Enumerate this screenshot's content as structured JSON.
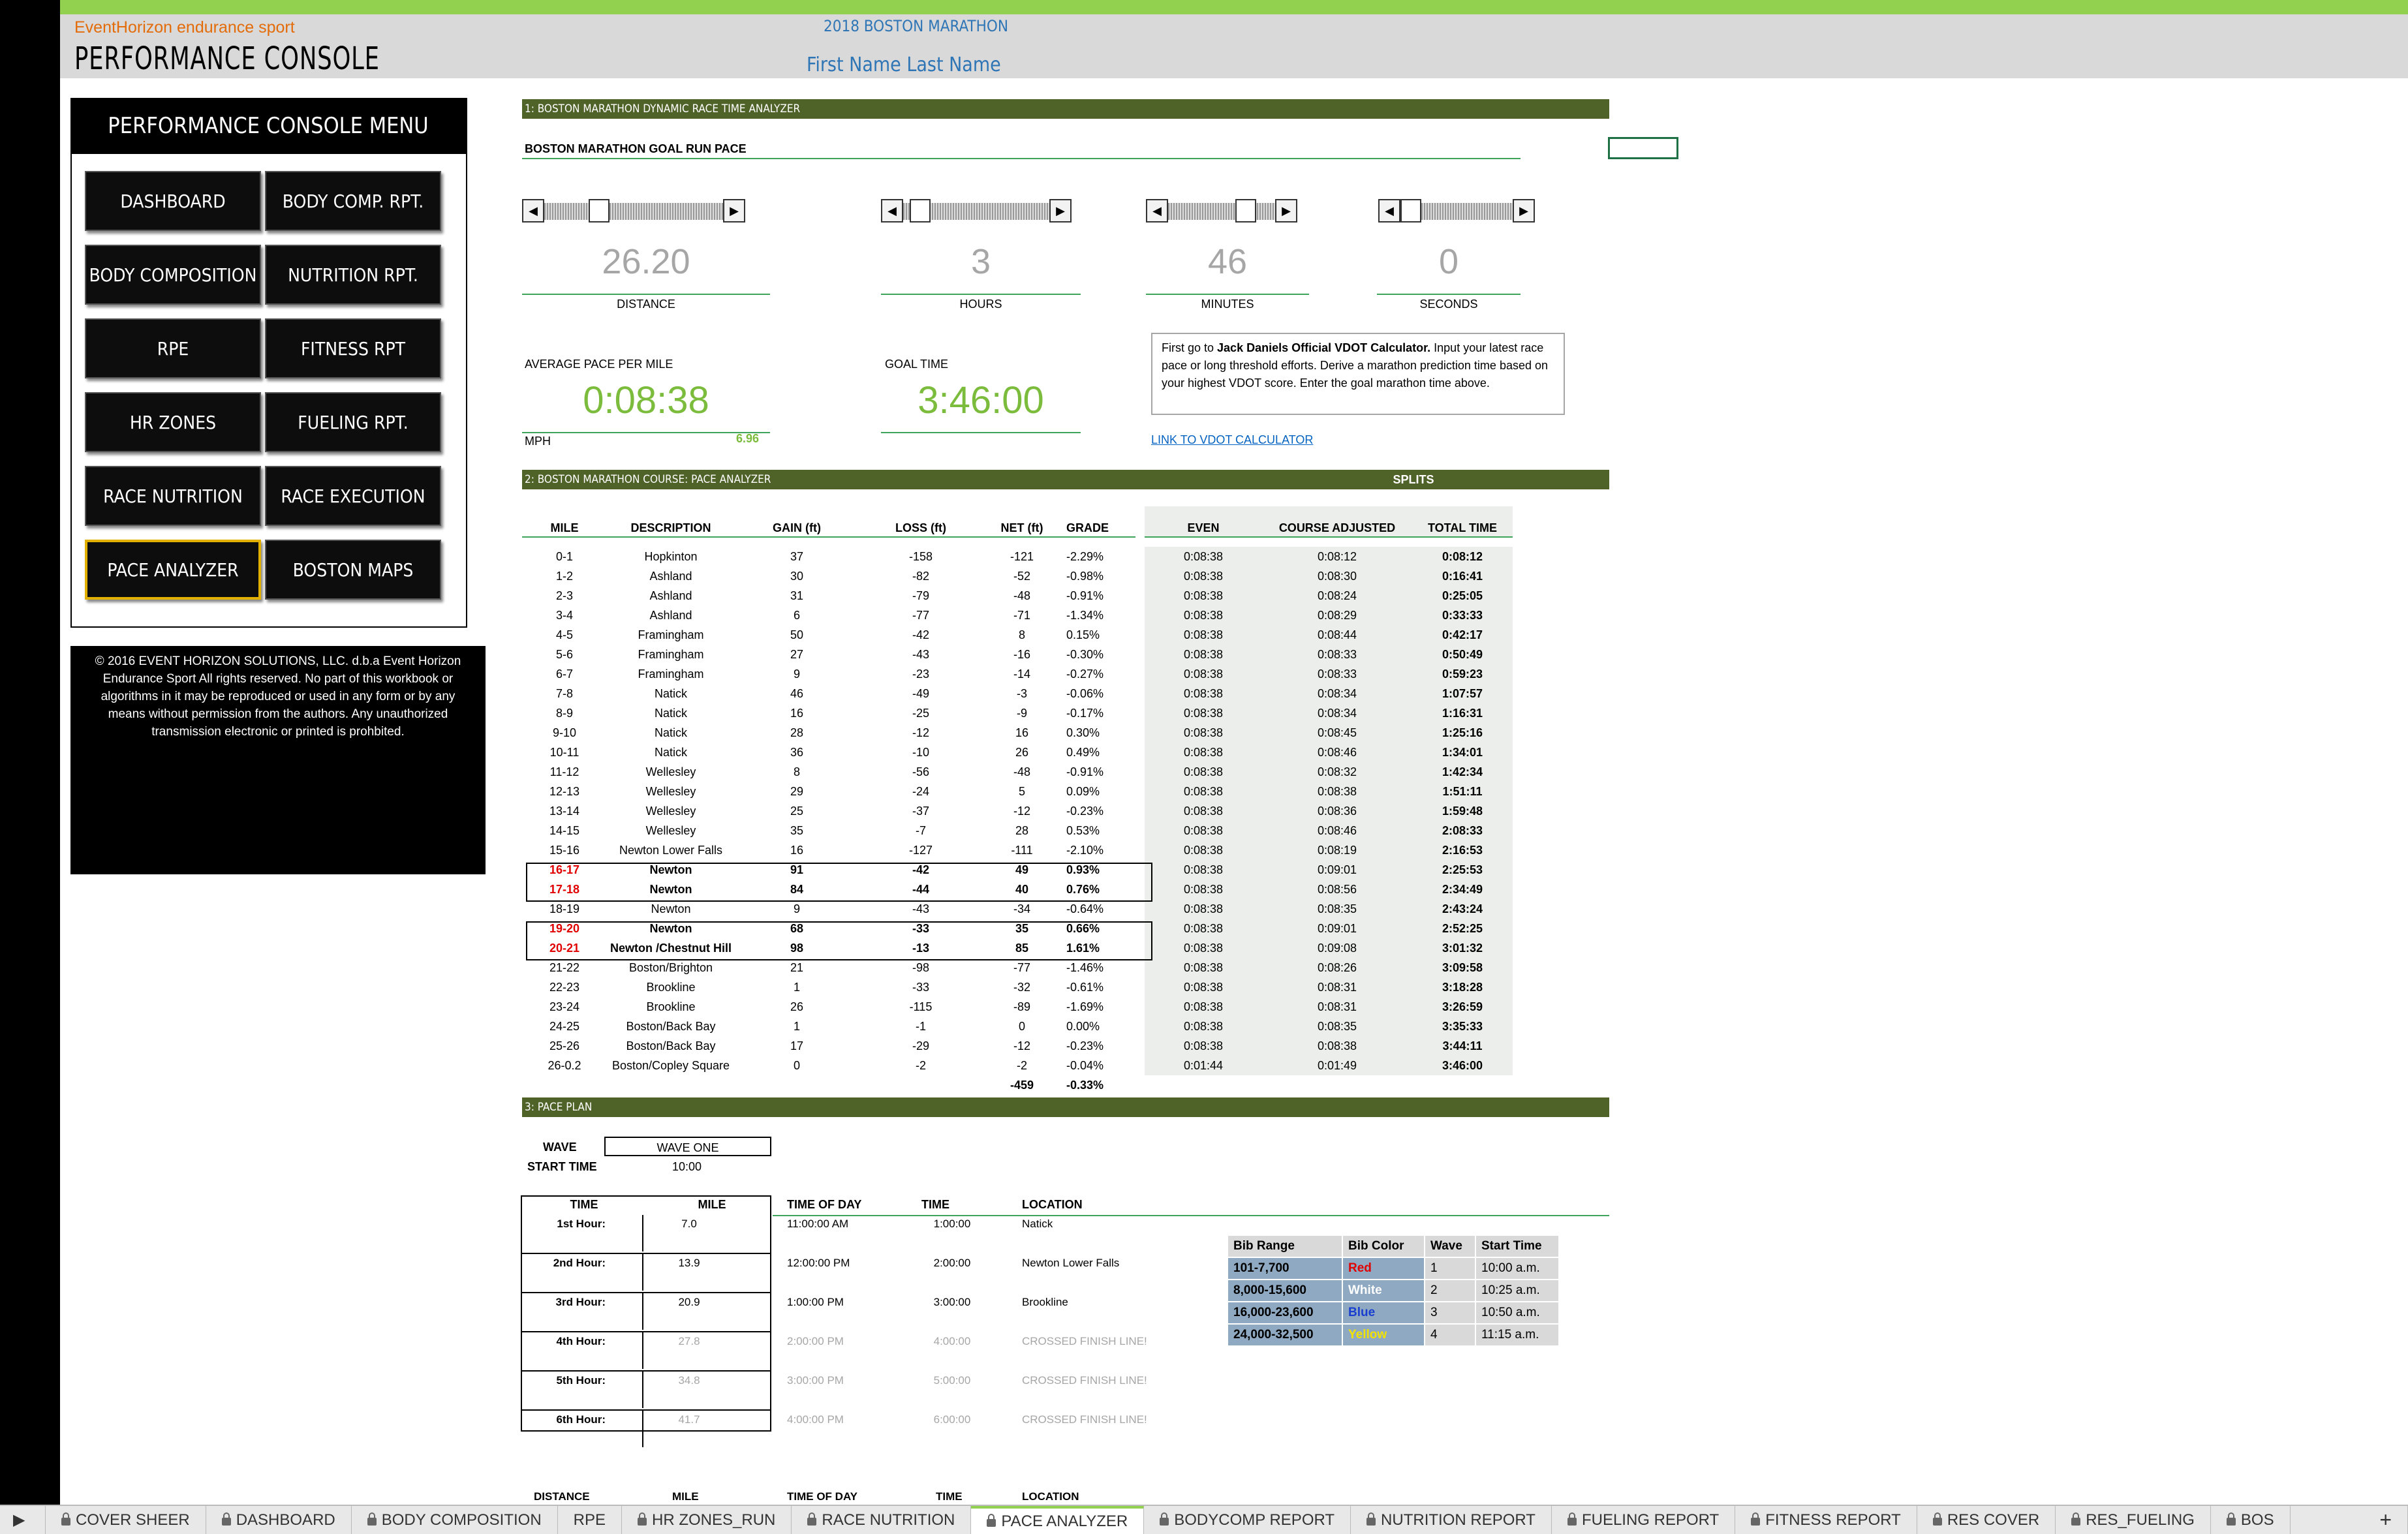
{
  "header": {
    "brand": "EventHorizon endurance sport",
    "title": "PERFORMANCE CONSOLE",
    "event": "2018 BOSTON MARATHON",
    "athlete": "First Name  Last Name"
  },
  "menu": {
    "title": "PERFORMANCE CONSOLE MENU",
    "buttons": [
      "DASHBOARD",
      "BODY COMP. RPT.",
      "BODY COMPOSITION",
      "NUTRITION RPT.",
      "RPE",
      "FITNESS RPT",
      "HR ZONES",
      "FUELING RPT.",
      "RACE NUTRITION",
      "RACE EXECUTION",
      "PACE ANALYZER",
      "BOSTON MAPS"
    ],
    "selected": "PACE ANALYZER"
  },
  "copyright": "© 2016 EVENT HORIZON SOLUTIONS, LLC. d.b.a Event Horizon Endurance Sport All rights reserved. No part of this workbook or algorithms in it may be reproduced or used in any form or by any means without permission from the authors. Any unauthorized transmission electronic or printed is prohbited.",
  "section1": {
    "bar": "1: BOSTON MARATHON DYNAMIC RACE TIME ANALYZER",
    "subtitle": "BOSTON MARATHON GOAL RUN PACE",
    "inputs": [
      {
        "value": "26.20",
        "label": "DISTANCE",
        "level": 0.28
      },
      {
        "value": "3",
        "label": "HOURS",
        "level": 0.05
      },
      {
        "value": "46",
        "label": "MINUTES",
        "level": 0.78
      },
      {
        "value": "0",
        "label": "SECONDS",
        "level": 0.0
      }
    ],
    "avg_label": "AVERAGE PACE PER MILE",
    "avg_value": "0:08:38",
    "goal_label": "GOAL TIME",
    "goal_value": "3:46:00",
    "mph_label": "MPH",
    "mph_value": "6.96",
    "note_pre": "First go to ",
    "note_bold": "Jack Daniels Official VDOT Calculator.",
    "note_post": " Input your latest race pace or long threshold efforts.  Derive a marathon prediction time based on your highest VDOT score. Enter the goal marathon time above.",
    "link": "LINK TO VDOT CALCULATOR"
  },
  "section2": {
    "bar": "2: BOSTON MARATHON COURSE: PACE ANALYZER",
    "splits_title": "SPLITS",
    "headers": [
      "MILE",
      "DESCRIPTION",
      "GAIN (ft)",
      "LOSS (ft)",
      "NET (ft)",
      "GRADE",
      "EVEN",
      "COURSE ADJUSTED",
      "TOTAL TIME"
    ],
    "rows": [
      [
        "0-1",
        "Hopkinton",
        "37",
        "-158",
        "-121",
        "-2.29%",
        "0:08:38",
        "0:08:12",
        "0:08:12"
      ],
      [
        "1-2",
        "Ashland",
        "30",
        "-82",
        "-52",
        "-0.98%",
        "0:08:38",
        "0:08:30",
        "0:16:41"
      ],
      [
        "2-3",
        "Ashland",
        "31",
        "-79",
        "-48",
        "-0.91%",
        "0:08:38",
        "0:08:24",
        "0:25:05"
      ],
      [
        "3-4",
        "Ashland",
        "6",
        "-77",
        "-71",
        "-1.34%",
        "0:08:38",
        "0:08:29",
        "0:33:33"
      ],
      [
        "4-5",
        "Framingham",
        "50",
        "-42",
        "8",
        "0.15%",
        "0:08:38",
        "0:08:44",
        "0:42:17"
      ],
      [
        "5-6",
        "Framingham",
        "27",
        "-43",
        "-16",
        "-0.30%",
        "0:08:38",
        "0:08:33",
        "0:50:49"
      ],
      [
        "6-7",
        "Framingham",
        "9",
        "-23",
        "-14",
        "-0.27%",
        "0:08:38",
        "0:08:33",
        "0:59:23"
      ],
      [
        "7-8",
        "Natick",
        "46",
        "-49",
        "-3",
        "-0.06%",
        "0:08:38",
        "0:08:34",
        "1:07:57"
      ],
      [
        "8-9",
        "Natick",
        "16",
        "-25",
        "-9",
        "-0.17%",
        "0:08:38",
        "0:08:34",
        "1:16:31"
      ],
      [
        "9-10",
        "Natick",
        "28",
        "-12",
        "16",
        "0.30%",
        "0:08:38",
        "0:08:45",
        "1:25:16"
      ],
      [
        "10-11",
        "Natick",
        "36",
        "-10",
        "26",
        "0.49%",
        "0:08:38",
        "0:08:46",
        "1:34:01"
      ],
      [
        "11-12",
        "Wellesley",
        "8",
        "-56",
        "-48",
        "-0.91%",
        "0:08:38",
        "0:08:32",
        "1:42:34"
      ],
      [
        "12-13",
        "Wellesley",
        "29",
        "-24",
        "5",
        "0.09%",
        "0:08:38",
        "0:08:38",
        "1:51:11"
      ],
      [
        "13-14",
        "Wellesley",
        "25",
        "-37",
        "-12",
        "-0.23%",
        "0:08:38",
        "0:08:36",
        "1:59:48"
      ],
      [
        "14-15",
        "Wellesley",
        "35",
        "-7",
        "28",
        "0.53%",
        "0:08:38",
        "0:08:46",
        "2:08:33"
      ],
      [
        "15-16",
        "Newton Lower Falls",
        "16",
        "-127",
        "-111",
        "-2.10%",
        "0:08:38",
        "0:08:19",
        "2:16:53"
      ],
      [
        "16-17",
        "Newton",
        "91",
        "-42",
        "49",
        "0.93%",
        "0:08:38",
        "0:09:01",
        "2:25:53"
      ],
      [
        "17-18",
        "Newton",
        "84",
        "-44",
        "40",
        "0.76%",
        "0:08:38",
        "0:08:56",
        "2:34:49"
      ],
      [
        "18-19",
        "Newton",
        "9",
        "-43",
        "-34",
        "-0.64%",
        "0:08:38",
        "0:08:35",
        "2:43:24"
      ],
      [
        "19-20",
        "Newton",
        "68",
        "-33",
        "35",
        "0.66%",
        "0:08:38",
        "0:09:01",
        "2:52:25"
      ],
      [
        "20-21",
        "Newton /Chestnut Hill",
        "98",
        "-13",
        "85",
        "1.61%",
        "0:08:38",
        "0:09:08",
        "3:01:32"
      ],
      [
        "21-22",
        "Boston/Brighton",
        "21",
        "-98",
        "-77",
        "-1.46%",
        "0:08:38",
        "0:08:26",
        "3:09:58"
      ],
      [
        "22-23",
        "Brookline",
        "1",
        "-33",
        "-32",
        "-0.61%",
        "0:08:38",
        "0:08:31",
        "3:18:28"
      ],
      [
        "23-24",
        "Brookline",
        "26",
        "-115",
        "-89",
        "-1.69%",
        "0:08:38",
        "0:08:31",
        "3:26:59"
      ],
      [
        "24-25",
        "Boston/Back Bay",
        "1",
        "-1",
        "0",
        "0.00%",
        "0:08:38",
        "0:08:35",
        "3:35:33"
      ],
      [
        "25-26",
        "Boston/Back Bay",
        "17",
        "-29",
        "-12",
        "-0.23%",
        "0:08:38",
        "0:08:38",
        "3:44:11"
      ],
      [
        "26-0.2",
        "Boston/Copley Square",
        "0",
        "-2",
        "-2",
        "-0.04%",
        "0:01:44",
        "0:01:49",
        "3:46:00"
      ]
    ],
    "highlight_rows": [
      16,
      17,
      19,
      20
    ],
    "totals": {
      "net": "-459",
      "grade": "-0.33%"
    }
  },
  "section3": {
    "bar": "3: PACE PLAN",
    "wave_label": "WAVE",
    "wave_value": "WAVE ONE",
    "start_label": "START TIME",
    "start_value": "10:00",
    "headers": [
      "TIME",
      "MILE",
      "TIME OF DAY",
      "TIME",
      "LOCATION"
    ],
    "rows": [
      [
        "1st Hour:",
        "7.0",
        "11:00:00 AM",
        "1:00:00",
        "Natick"
      ],
      [
        "2nd Hour:",
        "13.9",
        "12:00:00 PM",
        "2:00:00",
        "Newton Lower Falls"
      ],
      [
        "3rd Hour:",
        "20.9",
        "1:00:00 PM",
        "3:00:00",
        "Brookline"
      ],
      [
        "4th Hour:",
        "27.8",
        "2:00:00 PM",
        "4:00:00",
        "CROSSED FINISH LINE!"
      ],
      [
        "5th Hour:",
        "34.8",
        "3:00:00 PM",
        "5:00:00",
        "CROSSED FINISH LINE!"
      ],
      [
        "6th Hour:",
        "41.7",
        "4:00:00 PM",
        "6:00:00",
        "CROSSED FINISH LINE!"
      ]
    ],
    "faded_from": 3,
    "footer_headers": [
      "DISTANCE",
      "MILE",
      "TIME OF DAY",
      "TIME",
      "LOCATION"
    ],
    "bib": {
      "headers": [
        "Bib Range",
        "Bib Color",
        "Wave",
        "Start Time"
      ],
      "rows": [
        [
          "101-7,700",
          "Red",
          "1",
          "10:00 a.m."
        ],
        [
          "8,000-15,600",
          "White",
          "2",
          "10:25 a.m."
        ],
        [
          "16,000-23,600",
          "Blue",
          "3",
          "10:50 a.m."
        ],
        [
          "24,000-32,500",
          "Yellow",
          "4",
          "11:15 a.m."
        ]
      ],
      "colors": [
        "#e00000",
        "#ffffff",
        "#1a3fd0",
        "#f2e200"
      ]
    }
  },
  "tabs": [
    "COVER SHEER",
    "DASHBOARD",
    "BODY COMPOSITION",
    "RPE",
    "HR ZONES_RUN",
    "RACE NUTRITION",
    "PACE ANALYZER",
    "BODYCOMP REPORT",
    "NUTRITION REPORT",
    "FUELING REPORT",
    "FITNESS REPORT",
    "RES COVER",
    "RES_FUELING",
    "BOS"
  ],
  "active_tab": "PACE ANALYZER",
  "colors": {
    "accent": "#92d050",
    "section_bar": "#4f6228",
    "pace_green": "#7cbc3c",
    "link": "#0563c1"
  }
}
